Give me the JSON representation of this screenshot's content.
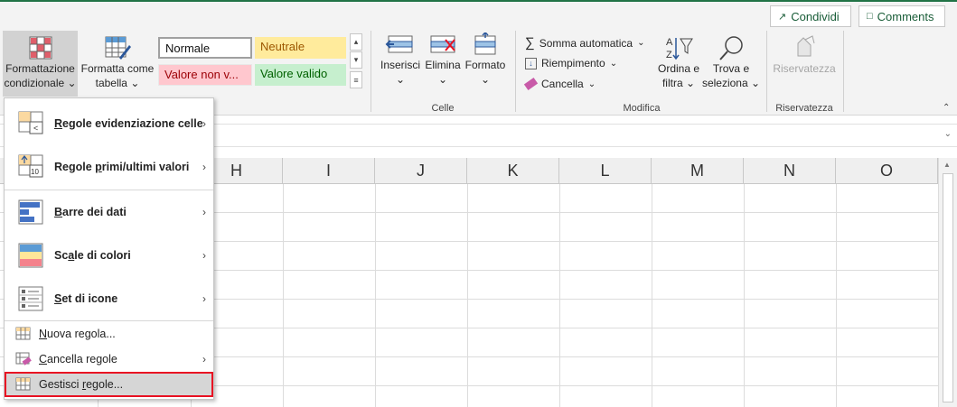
{
  "share_buttons": {
    "share": "Condividi",
    "comments": "Comments"
  },
  "ribbon": {
    "conditional_formatting": {
      "line1": "Formattazione",
      "line2": "condizionale"
    },
    "format_as_table": {
      "line1": "Formatta come",
      "line2": "tabella"
    },
    "cell_styles": {
      "normal": "Normale",
      "neutral": "Neutrale",
      "bad": "Valore non v...",
      "good": "Valore valido"
    },
    "cells_group": {
      "insert": "Inserisci",
      "delete": "Elimina",
      "format": "Formato",
      "group_label": "Celle"
    },
    "editing_group": {
      "autosum": "Somma automatica",
      "fill": "Riempimento",
      "clear": "Cancella",
      "sort_filter": {
        "line1": "Ordina e",
        "line2": "filtra"
      },
      "find_select": {
        "line1": "Trova e",
        "line2": "seleziona"
      },
      "group_label": "Modifica"
    },
    "privacy_group": {
      "sensitivity": "Riservatezza",
      "group_label": "Riservatezza"
    }
  },
  "columns": [
    "H",
    "I",
    "J",
    "K",
    "L",
    "M",
    "N",
    "O"
  ],
  "menu": {
    "highlight_rules": {
      "pre": "",
      "u": "R",
      "post": "egole evidenziazione celle"
    },
    "top_bottom_rules": {
      "pre": "Regole ",
      "u": "p",
      "post": "rimi/ultimi valori"
    },
    "data_bars": {
      "pre": "",
      "u": "B",
      "post": "arre dei dati"
    },
    "color_scales": {
      "pre": "Sc",
      "u": "a",
      "post": "le di colori"
    },
    "icon_sets": {
      "pre": "",
      "u": "S",
      "post": "et di icone"
    },
    "new_rule": {
      "pre": "",
      "u": "N",
      "post": "uova regola..."
    },
    "clear_rules": {
      "pre": "",
      "u": "C",
      "post": "ancella regole"
    },
    "manage_rules": {
      "pre": "Gestisci ",
      "u": "r",
      "post": "egole..."
    }
  },
  "colors": {
    "accent": "#217346",
    "neutral_fill": "#ffeb9c",
    "bad_fill": "#ffc7ce",
    "good_fill": "#c6efce",
    "highlight_border": "#e81123"
  }
}
